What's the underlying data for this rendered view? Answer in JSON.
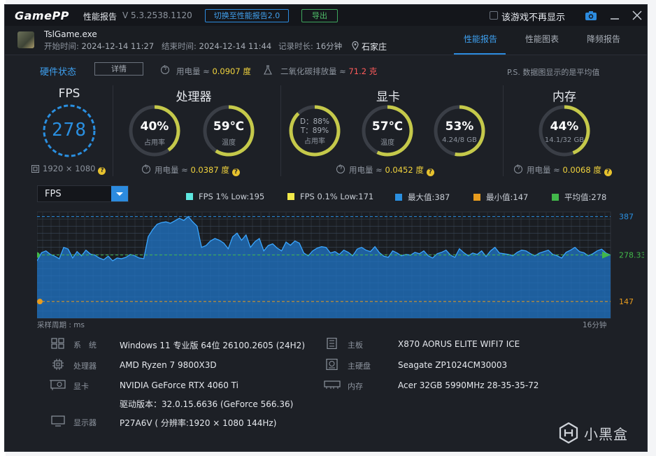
{
  "titlebar": {
    "logo": "GamePP",
    "title": "性能报告",
    "version": "V 5.3.2538.1120",
    "switch_button": "切换至性能报告2.0",
    "export_button": "导出",
    "checkbox_label": "该游戏不再显示"
  },
  "game": {
    "name": "TslGame.exe",
    "start_label": "开始时间:",
    "start_value": "2024-12-14 11:27",
    "end_label": "结束时间:",
    "end_value": "2024-12-14 11:44",
    "duration_label": "记录时长:",
    "duration_value": "16分钟",
    "city": "石家庄"
  },
  "tabs": [
    "性能报告",
    "性能图表",
    "降频报告"
  ],
  "hardware_status": {
    "title": "硬件状态",
    "detail_button": "详情",
    "power_label": "用电量 ≈",
    "power_value": "0.0907 度",
    "co2_label": "二氧化碳排放量 ≈",
    "co2_value": "71.2 克",
    "ps_note": "P.S. 数据图显示的是平均值"
  },
  "fps_panel": {
    "title": "FPS",
    "value": "278",
    "resolution": "1920 × 1080"
  },
  "cpu_panel": {
    "title": "处理器",
    "usage_value": "40%",
    "usage_label": "占用率",
    "usage_fraction": 0.4,
    "temp_value": "59℃",
    "temp_label": "温度",
    "temp_fraction": 0.59,
    "power_label": "用电量 ≈",
    "power_value": "0.0387 度"
  },
  "gpu_panel": {
    "title": "显卡",
    "usage_line1": "D：88%",
    "usage_line2": "T：89%",
    "usage_label": "占用率",
    "usage_fraction": 0.88,
    "temp_value": "57℃",
    "temp_label": "温度",
    "temp_fraction": 0.57,
    "vram_value": "53%",
    "vram_label": "4.24/8 GB",
    "vram_fraction": 0.53,
    "power_label": "用电量 ≈",
    "power_value": "0.0452 度"
  },
  "mem_panel": {
    "title": "内存",
    "usage_value": "44%",
    "usage_label": "14.1/32 GB",
    "usage_fraction": 0.44,
    "power_label": "用电量 ≈",
    "power_value": "0.0068 度"
  },
  "chart_controls": {
    "select_value": "FPS",
    "legend": [
      {
        "label": "FPS 1% Low:195",
        "color": "#5ee7e0"
      },
      {
        "label": "FPS 0.1% Low:171",
        "color": "#f2ea4a"
      },
      {
        "label": "最大值:387",
        "color": "#2a8fe0"
      },
      {
        "label": "最小值:147",
        "color": "#e89c1e"
      },
      {
        "label": "平均值:278",
        "color": "#42b84a"
      }
    ],
    "sample_period": "采样周期 : ms",
    "duration_end": "16分钟"
  },
  "chart_data": {
    "type": "area",
    "title": "",
    "xlabel": "",
    "ylabel": "",
    "series": [
      {
        "name": "FPS",
        "values": [
          262,
          285,
          290,
          280,
          275,
          268,
          300,
          295,
          270,
          288,
          276,
          292,
          281,
          278,
          270,
          265,
          275,
          262,
          270,
          268,
          272,
          280,
          276,
          270,
          268,
          330,
          350,
          365,
          370,
          372,
          368,
          375,
          382,
          376,
          387,
          372,
          360,
          300,
          305,
          318,
          325,
          320,
          312,
          296,
          330,
          340,
          320,
          335,
          300,
          316,
          325,
          290,
          305,
          310,
          298,
          290,
          315,
          306,
          318,
          312,
          284,
          276,
          290,
          298,
          302,
          300,
          284,
          288,
          280,
          292,
          286,
          276,
          295,
          300,
          292,
          288,
          302,
          285,
          275,
          272,
          290,
          284,
          276,
          280,
          278,
          286,
          282,
          290,
          276,
          270,
          282,
          286,
          292,
          278,
          272,
          296,
          285,
          276,
          284,
          280,
          290,
          274,
          290,
          300,
          284,
          282,
          280,
          276,
          286,
          292,
          290,
          282,
          276,
          284,
          288,
          292,
          280,
          276,
          270,
          286,
          292,
          300,
          288,
          285,
          276,
          282,
          290,
          295,
          284,
          278
        ]
      }
    ],
    "reference_lines": [
      {
        "name": "最大值",
        "value": 387
      },
      {
        "name": "平均值",
        "value": 278.33
      },
      {
        "name": "最小值",
        "value": 147
      }
    ],
    "y_tick_labels": [
      "387",
      "278.33",
      "147"
    ],
    "ylim": [
      100,
      400
    ]
  },
  "system_info": {
    "os_label": "系　统",
    "os_value": "Windows 11 专业版 64位 26100.2605 (24H2)",
    "cpu_label": "处理器",
    "cpu_value": "AMD Ryzen 7 9800X3D",
    "gpu_label": "显卡",
    "gpu_value": "NVIDIA GeForce RTX 4060 Ti",
    "driver_value": "驱动版本：32.0.15.6636 (GeForce 566.36)",
    "monitor_label": "显示器",
    "monitor_value": "P27A6V ( 分辨率:1920 × 1080 144Hz)",
    "board_label": "主板",
    "board_value": "X870 AORUS ELITE WIFI7 ICE",
    "disk_label": "主硬盘",
    "disk_value": "Seagate ZP1024CM30003",
    "ram_label": "内存",
    "ram_value": "Acer 32GB 5990MHz 28-35-35-72"
  },
  "watermark": "小黑盒",
  "colors": {
    "accent": "#2c8bdf",
    "gauge_track": "#3a3e46",
    "gauge_arc": "#c5c94a",
    "fps_ring": "#2a8fe0"
  }
}
